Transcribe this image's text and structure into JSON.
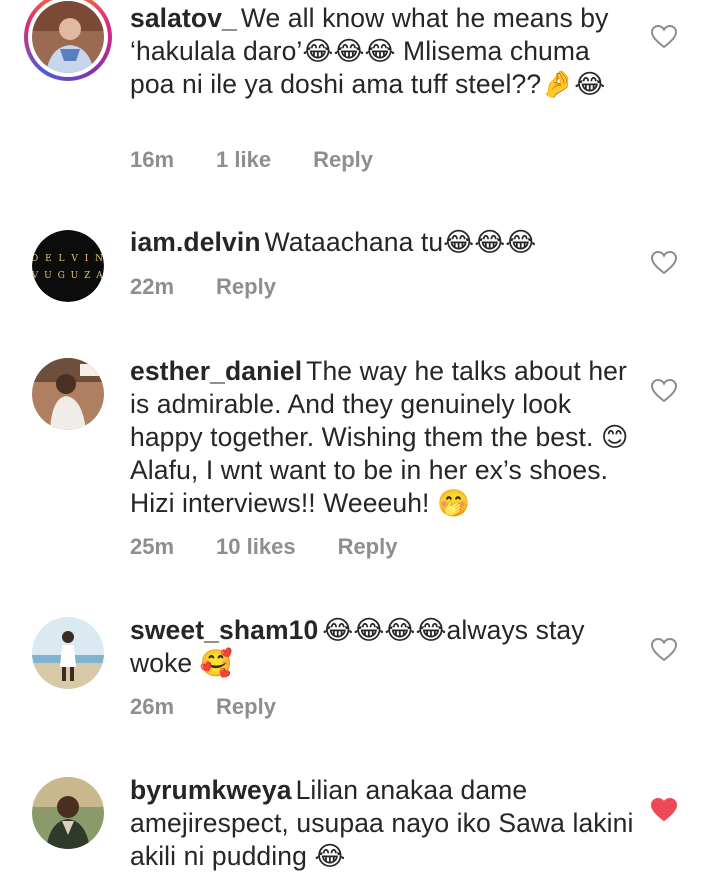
{
  "comments": [
    {
      "username": "salatov_",
      "text": "We all know what he means by ‘hakulala daro’😂😂😂 Mlisema chuma poa ni ile ya doshi ama tuff steel??🤌😂",
      "time": "16m",
      "likes": "1 like",
      "reply": "Reply",
      "liked": false
    },
    {
      "username": "iam.delvin",
      "text": "Wataachana tu😂😂😂",
      "time": "22m",
      "likes": "",
      "reply": "Reply",
      "liked": false,
      "avatar_text": [
        "DELVIN",
        "VUGUZA"
      ]
    },
    {
      "username": "esther_daniel",
      "text": "The way he talks about her is admirable. And they genuinely look happy together. Wishing them the best. 😊 Alafu, I wnt want to be in her ex’s shoes. Hizi interviews!! Weeeuh! 🤭",
      "time": "25m",
      "likes": "10 likes",
      "reply": "Reply",
      "liked": false
    },
    {
      "username": "sweet_sham10",
      "text": "😂😂😂😂always stay woke 🥰",
      "time": "26m",
      "likes": "",
      "reply": "Reply",
      "liked": false
    },
    {
      "username": "byrumkweya",
      "text": "Lilian anakaa dame amejirespect, usupaa nayo iko Sawa lakini akili ni pudding 😂",
      "time": "",
      "likes": "",
      "reply": "",
      "liked": true
    }
  ],
  "colors": {
    "text": "#262626",
    "meta": "#8e8e8e",
    "heart_liked": "#ed4956",
    "heart_outline": "#8e8e8e"
  }
}
